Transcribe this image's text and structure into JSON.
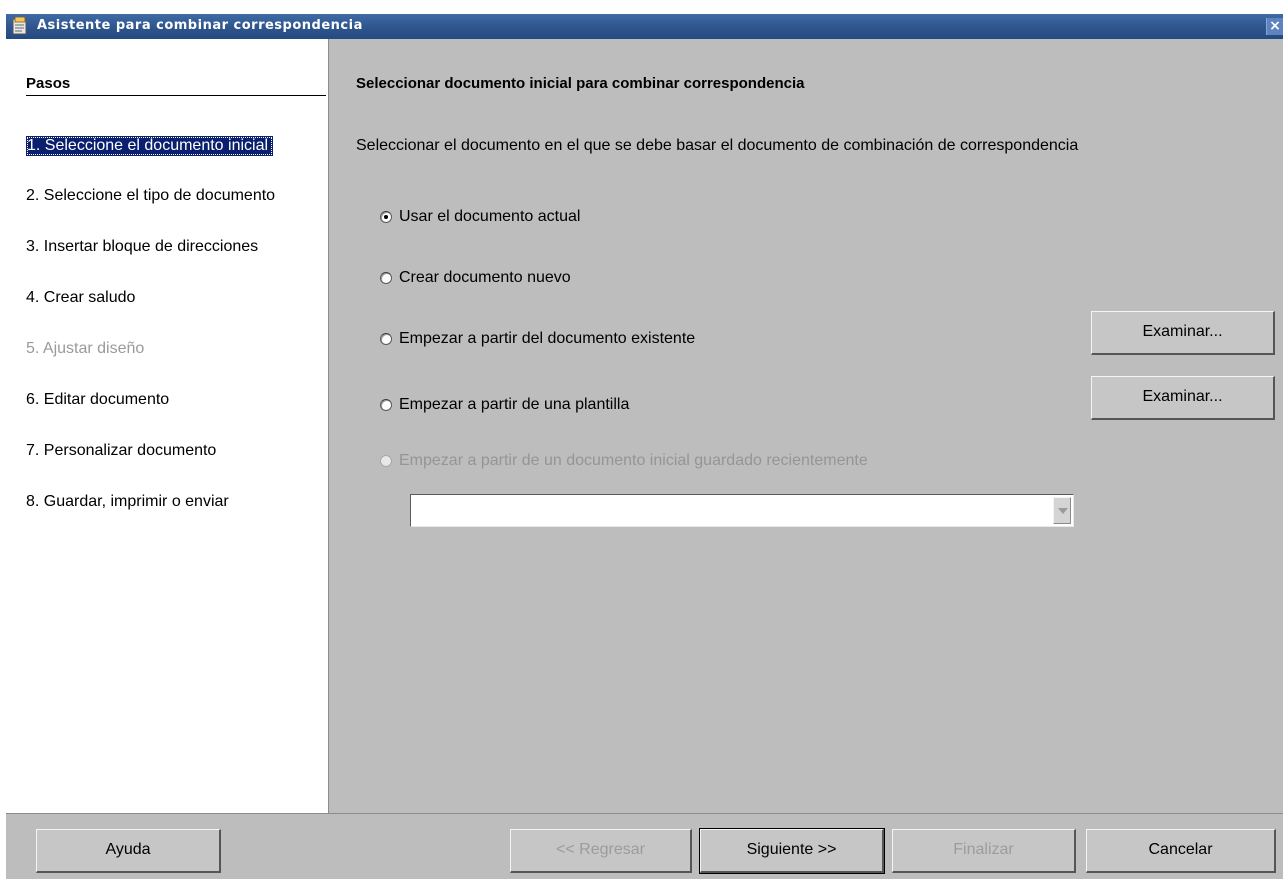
{
  "window": {
    "title": "Asistente para combinar correspondencia",
    "close_glyph": "×",
    "app_icon": "document-icon"
  },
  "sidebar": {
    "heading": "Pasos",
    "steps": [
      {
        "label": "1. Seleccione el documento inicial",
        "state": "active"
      },
      {
        "label": "2. Seleccione el tipo de documento",
        "state": "normal"
      },
      {
        "label": "3. Insertar bloque de direcciones",
        "state": "normal"
      },
      {
        "label": "4. Crear saludo",
        "state": "normal"
      },
      {
        "label": "5. Ajustar diseño",
        "state": "disabled"
      },
      {
        "label": "6. Editar documento",
        "state": "normal"
      },
      {
        "label": "7. Personalizar documento",
        "state": "normal"
      },
      {
        "label": "8. Guardar, imprimir o enviar",
        "state": "normal"
      }
    ]
  },
  "main": {
    "title": "Seleccionar documento inicial para combinar correspondencia",
    "description": "Seleccionar el documento en el que se debe basar el documento de combinación de correspondencia",
    "options": [
      {
        "label": "Usar el documento actual",
        "checked": true,
        "enabled": true
      },
      {
        "label": "Crear documento nuevo",
        "checked": false,
        "enabled": true
      },
      {
        "label": "Empezar a partir del documento existente",
        "checked": false,
        "enabled": true
      },
      {
        "label": "Empezar a partir de una plantilla",
        "checked": false,
        "enabled": true
      },
      {
        "label": "Empezar a partir de un documento inicial guardado recientemente",
        "checked": false,
        "enabled": false
      }
    ],
    "browse_label_1": "Examinar...",
    "browse_label_2": "Examinar...",
    "recent_value": ""
  },
  "footer": {
    "help": "Ayuda",
    "back": "<< Regresar",
    "next": "Siguiente >>",
    "finish": "Finalizar",
    "cancel": "Cancelar"
  },
  "colors": {
    "titlebar": "#30568e",
    "dialog_bg": "#bdbdbd",
    "selection": "#0a1f6e",
    "disabled_text": "#9a9a9a"
  }
}
